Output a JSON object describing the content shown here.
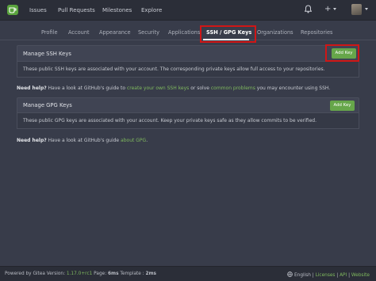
{
  "navbar": {
    "links": [
      "Issues",
      "Pull Requests",
      "Milestones",
      "Explore"
    ],
    "plus_label": "+"
  },
  "tabs": [
    "Profile",
    "Account",
    "Appearance",
    "Security",
    "Applications",
    "SSH / GPG Keys",
    "Organizations",
    "Repositories"
  ],
  "active_tab": "SSH / GPG Keys",
  "ssh": {
    "title": "Manage SSH Keys",
    "add_label": "Add Key",
    "description": "These public SSH keys are associated with your account. The corresponding private keys allow full access to your repositories."
  },
  "ssh_help": {
    "prefix": "Need help?",
    "text1": " Have a look at GitHub's guide to ",
    "link1": "create your own SSH keys",
    "text2": " or solve ",
    "link2": "common problems",
    "text3": " you may encounter using SSH."
  },
  "gpg": {
    "title": "Manage GPG Keys",
    "add_label": "Add Key",
    "description": "These public GPG keys are associated with your account. Keep your private keys safe as they allow commits to be verified."
  },
  "gpg_help": {
    "prefix": "Need help?",
    "text1": " Have a look at GitHub's guide ",
    "link1": "about GPG",
    "text2": "."
  },
  "footer": {
    "powered": "Powered by Gitea Version: ",
    "version": "1.17.0+rc1",
    "page_label": " Page: ",
    "page_time": "6ms",
    "template_label": " Template : ",
    "template_time": "2ms",
    "language": "English",
    "licenses": "Licenses",
    "api": "API",
    "website": "Website",
    "sep": "|"
  },
  "colors": {
    "accent_green": "#66a64a",
    "highlight_red": "#d01616"
  }
}
